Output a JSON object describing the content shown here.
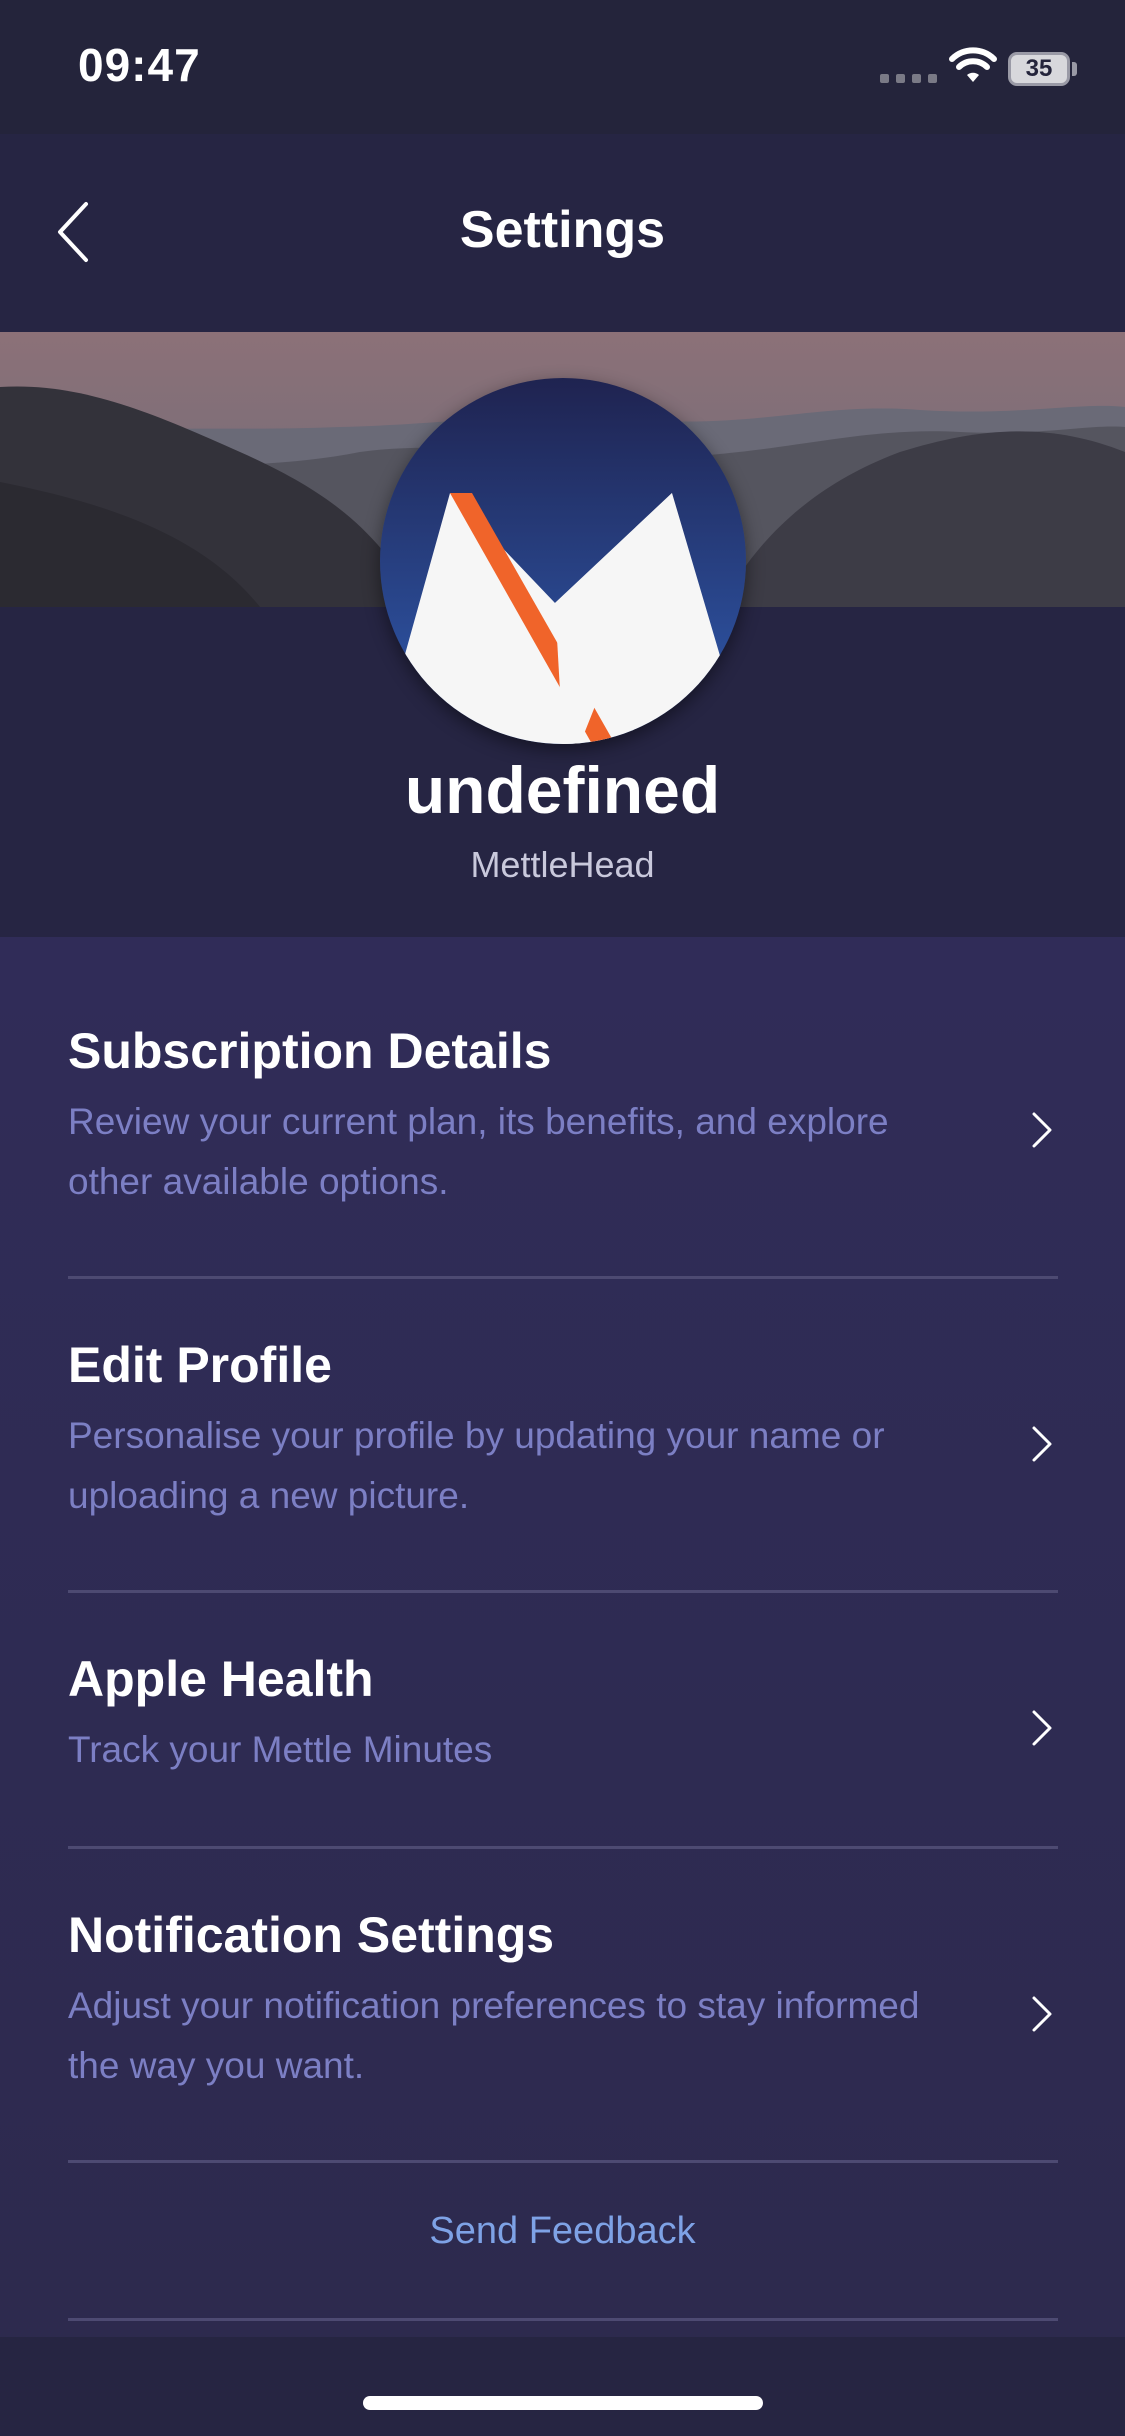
{
  "status_bar": {
    "time": "09:47",
    "battery_level": "35",
    "icons": [
      "signal-icon",
      "wifi-icon",
      "battery-icon"
    ]
  },
  "nav": {
    "title": "Settings",
    "back_icon": "chevron-left-icon"
  },
  "profile": {
    "name": "undefined",
    "subtitle": "MettleHead",
    "avatar": "mettle-logo"
  },
  "settings": {
    "items": [
      {
        "title": "Subscription Details",
        "description": "Review your current plan, its benefits, and explore other available options."
      },
      {
        "title": "Edit Profile",
        "description": "Personalise your profile by updating your name or uploading a new picture."
      },
      {
        "title": "Apple Health",
        "description": "Track your Mettle Minutes"
      },
      {
        "title": "Notification Settings",
        "description": "Adjust your notification preferences to stay informed the way you want."
      }
    ],
    "feedback_label": "Send Feedback"
  },
  "colors": {
    "background": "#262543",
    "list_background": "#302c58",
    "description_text": "#7c7fc4",
    "link": "#7ea2e6",
    "brand_orange": "#f0642a",
    "brand_blue": "#2f5bb0"
  }
}
